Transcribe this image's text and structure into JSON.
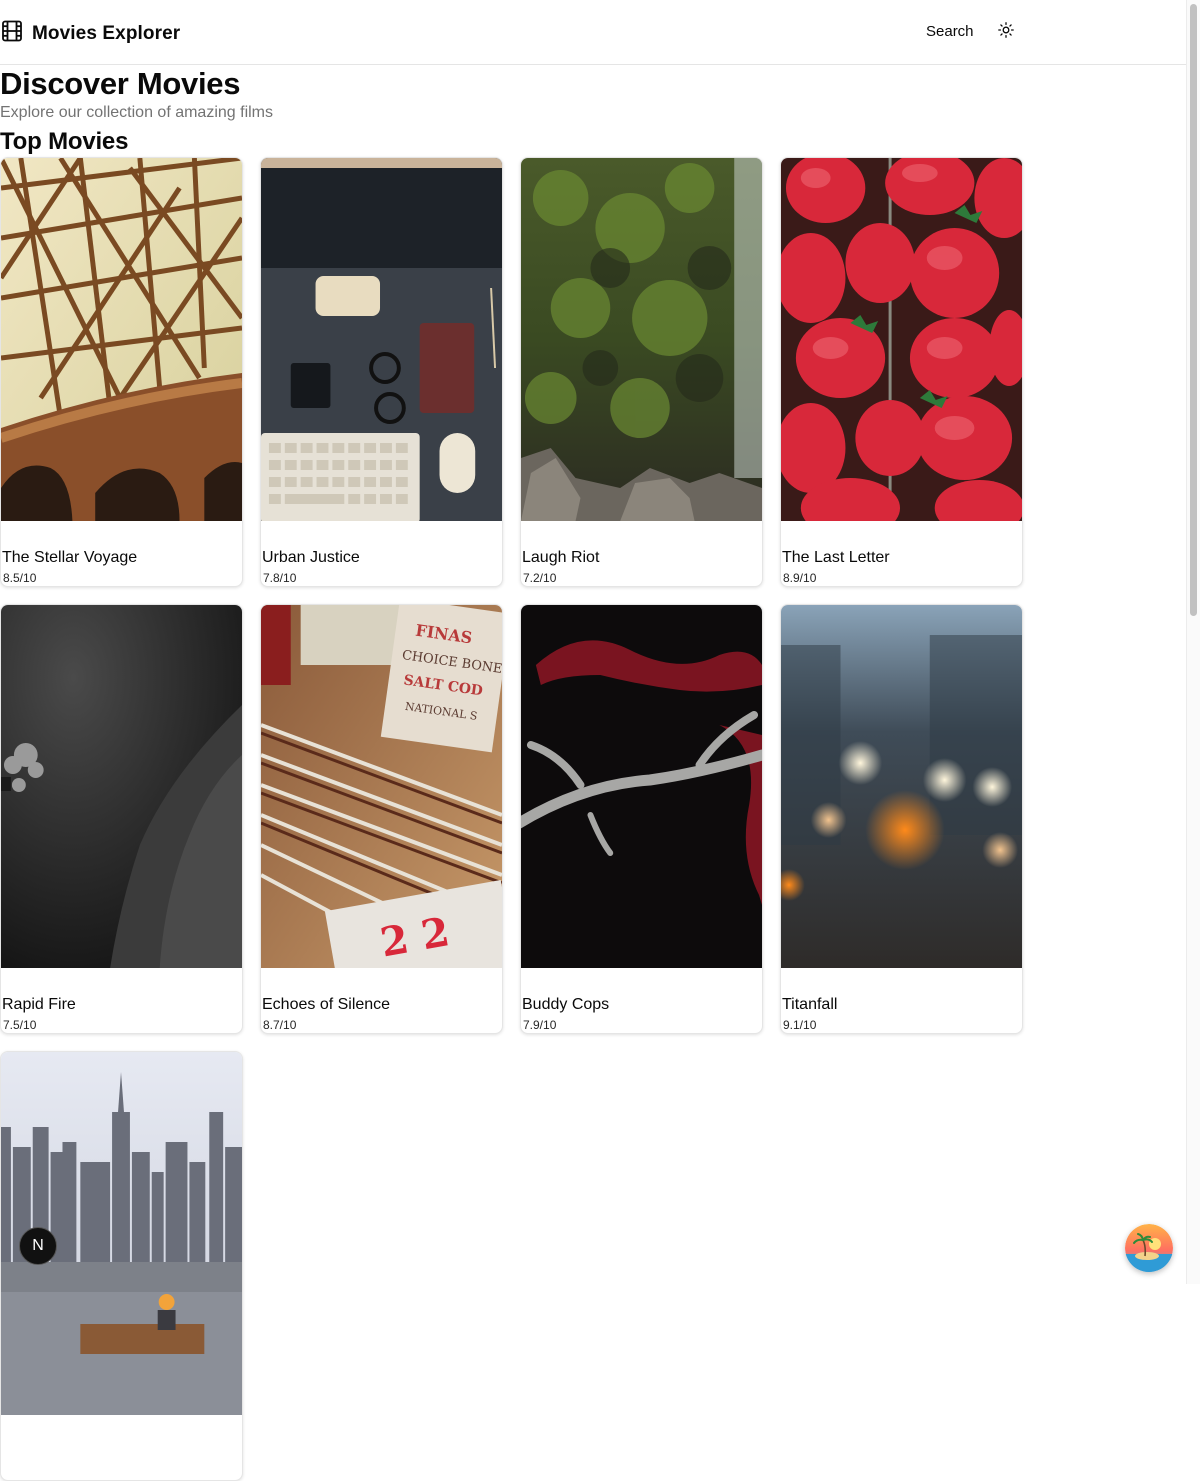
{
  "header": {
    "app_title": "Movies Explorer",
    "logo_icon": "film-icon",
    "search_label": "Search",
    "theme_icon": "sun-icon"
  },
  "hero": {
    "title": "Discover Movies",
    "subtitle": "Explore our collection of amazing films"
  },
  "section": {
    "title": "Top Movies"
  },
  "movies": [
    {
      "title": "The Stellar Voyage",
      "rating": "8.5/10",
      "poster": "bridge-photo"
    },
    {
      "title": "Urban Justice",
      "rating": "7.8/10",
      "poster": "desk-flatlay-photo"
    },
    {
      "title": "Laugh Riot",
      "rating": "7.2/10",
      "poster": "mossy-waterfall-photo"
    },
    {
      "title": "The Last Letter",
      "rating": "8.9/10",
      "poster": "strawberries-photo"
    },
    {
      "title": "Rapid Fire",
      "rating": "7.5/10",
      "poster": "underwater-diver-photo"
    },
    {
      "title": "Echoes of Silence",
      "rating": "8.7/10",
      "poster": "letterpress-photo"
    },
    {
      "title": "Buddy Cops",
      "rating": "7.9/10",
      "poster": "antler-ribbon-photo"
    },
    {
      "title": "Titanfall",
      "rating": "9.1/10",
      "poster": "bokeh-street-photo"
    },
    {
      "title": "",
      "rating": "",
      "poster": "city-skyline-photo"
    }
  ],
  "overlay": {
    "next_badge": "N",
    "fab_icon": "island-avatar-icon"
  },
  "colors": {
    "text": "#0a0a0a",
    "muted": "#737373",
    "border": "#e5e5e5"
  }
}
